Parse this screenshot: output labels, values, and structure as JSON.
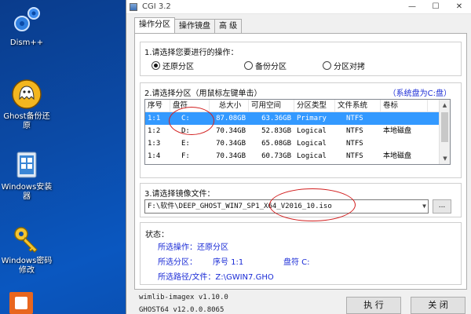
{
  "desktop": {
    "icons": [
      {
        "label": "Dism++",
        "icon": "gear-icon"
      },
      {
        "label": "Ghost备份还原",
        "icon": "ghost-icon"
      },
      {
        "label": "Windows安装器",
        "icon": "installer-icon"
      },
      {
        "label": "Windows密码修改",
        "icon": "key-icon"
      }
    ]
  },
  "window": {
    "title": "CGI 3.2",
    "minimize": "—",
    "maximize": "☐",
    "close": "✕"
  },
  "tabs": [
    "操作分区",
    "操作镜盘",
    "高 级"
  ],
  "step1": {
    "title": "1.请选择您要进行的操作：",
    "options": [
      "还原分区",
      "备份分区",
      "分区对拷"
    ],
    "selected": "还原分区"
  },
  "step2": {
    "title": "2.请选择分区（用鼠标左键单击）",
    "system_disk": "（系统盘为C:盘）",
    "columns": [
      "序号",
      "盘符",
      "总大小",
      "可用空间",
      "分区类型",
      "文件系统",
      "卷标"
    ],
    "rows": [
      [
        "1:1",
        "C:",
        "87.08GB",
        "63.36GB",
        "Primary",
        "NTFS",
        ""
      ],
      [
        "1:2",
        "D:",
        "70.34GB",
        "52.83GB",
        "Logical",
        "NTFS",
        "本地磁盘"
      ],
      [
        "1:3",
        "E:",
        "70.34GB",
        "65.08GB",
        "Logical",
        "NTFS",
        ""
      ],
      [
        "1:4",
        "F:",
        "70.34GB",
        "60.73GB",
        "Logical",
        "NTFS",
        "本地磁盘"
      ]
    ],
    "selected_row": 0
  },
  "step3": {
    "title": "3.请选择镜像文件：",
    "path": "F:\\软件\\DEEP_GHOST_WIN7_SP1_X64_V2016_10.iso",
    "browse": "..."
  },
  "status": {
    "title": "状态：",
    "operation": "所选操作：还原分区",
    "partition_label": "所选分区：",
    "seq_label": "序号 1:1",
    "drive_label": "盘符 C:",
    "path_line": "所选路径/文件：Z:\\GWIN7.GHO"
  },
  "footer": {
    "line1": "wimlib-imagex v1.10.0",
    "line2": "GHOST64 v12.0.0.8065",
    "execute": "执 行",
    "close": "关 闭"
  },
  "colors": {
    "selection": "#3399ff",
    "info_blue": "#1a2bd6",
    "annotation_red": "#d21e1e"
  }
}
